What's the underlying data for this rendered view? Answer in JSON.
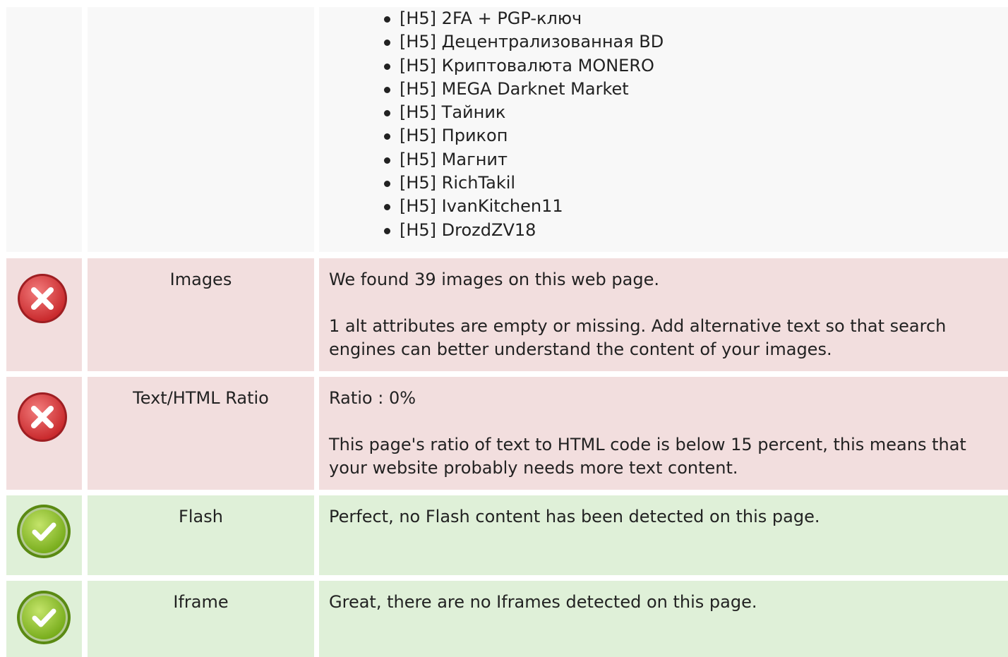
{
  "headings": {
    "items": [
      "[H5] 2FA + PGP-ключ",
      "[H5] Децентрализованная BD",
      "[H5] Криптовалюта MONERO",
      "[H5] MEGA Darknet Market",
      "[H5] Тайник",
      "[H5] Прикоп",
      "[H5] Магнит",
      "[H5] RichTakil",
      "[H5] IvanKitchen11",
      "[H5] DrozdZV18"
    ]
  },
  "checks": {
    "images": {
      "status": "fail",
      "icon": "error-x-icon",
      "label": "Images",
      "line1": "We found 39 images on this web page.",
      "line2": "1 alt attributes are empty or missing. Add alternative text so that search engines can better understand the content of your images."
    },
    "ratio": {
      "status": "fail",
      "icon": "error-x-icon",
      "label": "Text/HTML Ratio",
      "line1": "Ratio : 0%",
      "line2": "This page's ratio of text to HTML code is below 15 percent, this means that your website probably needs more text content."
    },
    "flash": {
      "status": "pass",
      "icon": "checkmark-icon",
      "label": "Flash",
      "line1": "Perfect, no Flash content has been detected on this page."
    },
    "iframe": {
      "status": "pass",
      "icon": "checkmark-icon",
      "label": "Iframe",
      "line1": "Great, there are no Iframes detected on this page."
    }
  },
  "colors": {
    "fail_bg": "#f2dede",
    "pass_bg": "#dff0d8",
    "neutral_bg": "#f8f8f8",
    "fail_icon": "#d9393b",
    "pass_icon": "#8cc026"
  }
}
